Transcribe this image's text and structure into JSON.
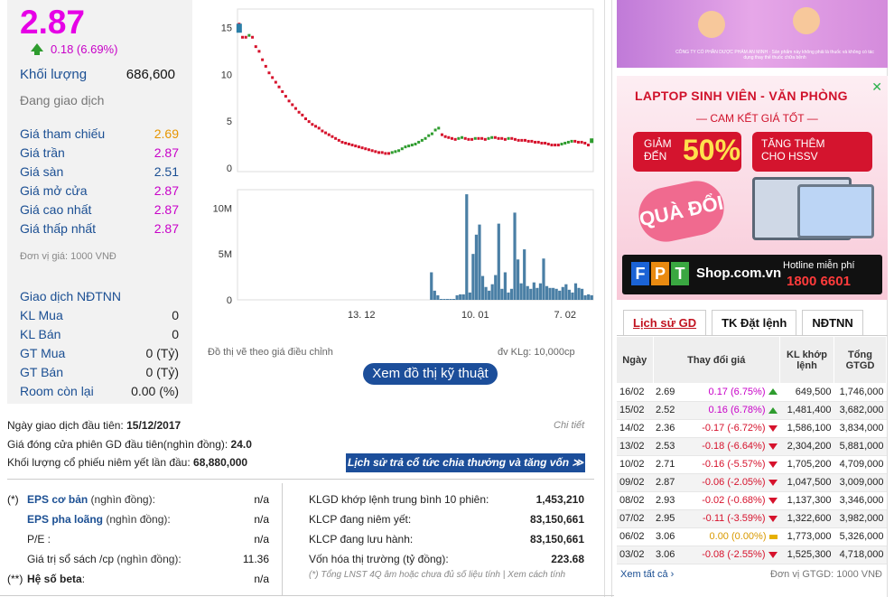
{
  "price": {
    "current": "2.87",
    "change": "0.18 (6.69%)",
    "volume_label": "Khối lượng",
    "volume_value": "686,600",
    "status": "Đang giao dịch"
  },
  "ref_prices": [
    {
      "label": "Giá tham chiếu",
      "value": "2.69",
      "color": "#e69500"
    },
    {
      "label": "Giá trần",
      "value": "2.87",
      "color": "#c800c8"
    },
    {
      "label": "Giá sàn",
      "value": "2.51",
      "color": "#1b4f93"
    },
    {
      "label": "Giá mở cửa",
      "value": "2.87",
      "color": "#c800c8"
    },
    {
      "label": "Giá cao nhất",
      "value": "2.87",
      "color": "#c800c8"
    },
    {
      "label": "Giá thấp nhất",
      "value": "2.87",
      "color": "#c800c8"
    }
  ],
  "unit_note": "Đơn vị giá: 1000 VNĐ",
  "foreign": {
    "title": "Giao dịch NĐTNN",
    "rows": [
      {
        "label": "KL Mua",
        "value": "0"
      },
      {
        "label": "KL Bán",
        "value": "0"
      },
      {
        "label": "GT Mua",
        "value": "0 (Tỷ)"
      },
      {
        "label": "GT Bán",
        "value": "0 (Tỷ)"
      },
      {
        "label": "Room còn lại",
        "value": "0.00 (%)"
      }
    ]
  },
  "chart_data": [
    {
      "type": "line",
      "series": [],
      "y_ticks": [
        "15",
        "10",
        "5",
        "0"
      ],
      "ylim": [
        0,
        16
      ],
      "x": [
        0,
        1,
        2,
        3,
        4,
        5,
        6,
        7,
        8,
        9,
        10,
        11,
        12,
        13,
        14,
        15,
        16,
        17,
        18,
        19,
        20,
        21,
        22,
        23,
        24,
        25,
        26,
        27,
        28,
        29,
        30,
        31,
        32,
        33,
        34,
        35,
        36,
        37,
        38,
        39,
        40,
        41,
        42,
        43,
        44,
        45,
        46,
        47,
        48,
        49,
        50,
        51,
        52,
        53,
        54,
        55,
        56,
        57,
        58,
        59,
        60,
        61,
        62,
        63,
        64,
        65,
        66,
        67,
        68,
        69,
        70,
        71,
        72,
        73,
        74,
        75,
        76,
        77,
        78,
        79,
        80,
        81,
        82,
        83,
        84,
        85,
        86,
        87,
        88,
        89,
        90,
        91,
        92,
        93,
        94,
        95,
        96,
        97,
        98,
        99,
        100,
        101,
        102,
        103,
        104,
        105,
        106
      ],
      "values": [
        15.4,
        14.0,
        14.0,
        14.2,
        14.0,
        13.0,
        12.5,
        11.6,
        10.9,
        10.2,
        9.7,
        9.2,
        8.7,
        8.2,
        7.7,
        7.2,
        6.8,
        6.4,
        6.0,
        5.7,
        5.3,
        5.0,
        4.7,
        4.5,
        4.3,
        4.0,
        3.8,
        3.6,
        3.4,
        3.2,
        3.0,
        2.8,
        2.7,
        2.6,
        2.5,
        2.4,
        2.3,
        2.2,
        2.1,
        2.0,
        1.9,
        1.8,
        1.7,
        1.7,
        1.6,
        1.6,
        1.7,
        1.8,
        1.9,
        2.1,
        2.3,
        2.4,
        2.5,
        2.6,
        2.8,
        3.0,
        3.2,
        3.5,
        3.7,
        4.1,
        4.3,
        3.6,
        3.4,
        3.3,
        3.2,
        3.1,
        3.2,
        3.3,
        3.2,
        3.1,
        3.1,
        3.2,
        3.2,
        3.2,
        3.1,
        3.2,
        3.3,
        3.3,
        3.2,
        3.2,
        3.1,
        3.2,
        3.2,
        3.1,
        3.0,
        3.0,
        3.0,
        2.9,
        2.9,
        2.8,
        2.8,
        2.7,
        2.7,
        2.6,
        2.5,
        2.5,
        2.5,
        2.6,
        2.7,
        2.8,
        2.9,
        2.9,
        2.8,
        2.8,
        2.7,
        2.5,
        2.87
      ]
    },
    {
      "type": "bar",
      "y_ticks": [
        "10M",
        "5M",
        "0"
      ],
      "ylim": [
        0,
        12
      ],
      "x_ticks": [
        "13. 12",
        "10. 01",
        "7. 02"
      ],
      "values": [
        0,
        0,
        0,
        0,
        0,
        0,
        0,
        0,
        0,
        0,
        0,
        0,
        0,
        0,
        0,
        0,
        0,
        0,
        0,
        0,
        0,
        0,
        0,
        0,
        0,
        0,
        0,
        0,
        0,
        0,
        0,
        0,
        0,
        0,
        0,
        0,
        0,
        0,
        0,
        0,
        0,
        0,
        0,
        0,
        0,
        0,
        0,
        0,
        0,
        0,
        0,
        0,
        0,
        0,
        0,
        0,
        0,
        0,
        0,
        0,
        3.0,
        1.0,
        0.5,
        0.1,
        0.1,
        0.1,
        0.1,
        0.1,
        0.5,
        0.6,
        0.6,
        11.5,
        0.8,
        5.0,
        7.1,
        8.2,
        2.6,
        1.4,
        1.0,
        1.7,
        2.7,
        8.3,
        1.2,
        3.0,
        0.8,
        1.2,
        9.5,
        4.4,
        1.8,
        5.5,
        1.5,
        1.2,
        1.9,
        1.3,
        1.8,
        4.5,
        1.5,
        1.3,
        1.3,
        1.2,
        1.0,
        1.4,
        1.7,
        1.1,
        0.8,
        1.8,
        1.3,
        1.2,
        0.5,
        0.6,
        0.5
      ]
    }
  ],
  "chart_note": "Đồ thị vẽ theo giá điều chỉnh",
  "chart_unit": "đv KLg: 10,000cp",
  "tech_button": "Xem đồ thị kỹ thuật",
  "first_day": {
    "label": "Ngày giao dịch đầu tiên:",
    "value": "15/12/2017"
  },
  "detail_link": "Chi tiết",
  "first_close": {
    "label": "Giá đóng cửa phiên GD đầu tiên(nghìn đồng):",
    "value": "24.0"
  },
  "listed_vol": {
    "label": "Khối lượng cổ phiếu niêm yết lần đầu:",
    "value": "68,880,000"
  },
  "dividend_button": "Lịch sử trả cổ tức chia thưởng và tăng vốn ≫",
  "eps_rows": [
    {
      "mark": "(*)",
      "name": "EPS cơ bản",
      "sub": " (nghìn đồng):",
      "value": "n/a"
    },
    {
      "mark": "",
      "name": "EPS pha loãng",
      "sub": " (nghìn đồng):",
      "value": "n/a"
    },
    {
      "mark": "",
      "name": "P/E",
      "sub": " :",
      "value": "n/a"
    },
    {
      "mark": "",
      "name": "Giá trị sổ sách /cp",
      "sub": " (nghìn đồng):",
      "value": "11.36"
    },
    {
      "mark": "(**)",
      "name": "Hệ số beta",
      "sub": ":",
      "value": "n/a"
    }
  ],
  "klgd_rows": [
    {
      "label": "KLGD khớp lệnh trung bình 10 phiên:",
      "value": "1,453,210"
    },
    {
      "label": "KLCP đang niêm yết:",
      "value": "83,150,661"
    },
    {
      "label": "KLCP đang lưu hành:",
      "value": "83,150,661"
    },
    {
      "label": "Vốn hóa thị trường",
      "sub": " (tỷ đồng):",
      "value": "223.68"
    }
  ],
  "foot_note": "(*) Tổng LNST 4Q âm hoặc chưa đủ số liệu tính | Xem cách tính",
  "ad1_text": "CÔNG TY CỔ PHẦN DƯỢC PHẨM AN MINH · Sản phẩm này không phải là thuốc và không có tác dụng thay thế thuốc chữa bệnh",
  "ad2": {
    "title": "LAPTOP SINH VIÊN - VĂN PHÒNG",
    "sub": "— CAM KẾT GIÁ TỐT —",
    "box1_a": "GIẢM",
    "box1_b": "ĐẾN",
    "box1_big": "50%",
    "box2_a": "TĂNG THÊM",
    "box2_b": "CHO HSSV",
    "upgrade": "QUÀ ĐỔI",
    "shop": "Shop.com.vn",
    "hotline": "Hotline miễn phí",
    "hotline_num": "1800 6601"
  },
  "tabs": [
    "Lịch sử GD",
    "TK Đặt lệnh",
    "NĐTNN"
  ],
  "history_headers": [
    "Ngày",
    "Thay đổi giá",
    "KL khớp lệnh",
    "Tổng GTGD"
  ],
  "history": [
    {
      "date": "16/02",
      "price": "2.69",
      "change": "0.17 (6.75%)",
      "dir": "up",
      "vol": "649,500",
      "val": "1,746,000"
    },
    {
      "date": "15/02",
      "price": "2.52",
      "change": "0.16 (6.78%)",
      "dir": "up",
      "vol": "1,481,400",
      "val": "3,682,000"
    },
    {
      "date": "14/02",
      "price": "2.36",
      "change": "-0.17 (-6.72%)",
      "dir": "down",
      "vol": "1,586,100",
      "val": "3,834,000"
    },
    {
      "date": "13/02",
      "price": "2.53",
      "change": "-0.18 (-6.64%)",
      "dir": "down",
      "vol": "2,304,200",
      "val": "5,881,000"
    },
    {
      "date": "10/02",
      "price": "2.71",
      "change": "-0.16 (-5.57%)",
      "dir": "down",
      "vol": "1,705,200",
      "val": "4,709,000"
    },
    {
      "date": "09/02",
      "price": "2.87",
      "change": "-0.06 (-2.05%)",
      "dir": "down",
      "vol": "1,047,500",
      "val": "3,009,000"
    },
    {
      "date": "08/02",
      "price": "2.93",
      "change": "-0.02 (-0.68%)",
      "dir": "down",
      "vol": "1,137,300",
      "val": "3,346,000"
    },
    {
      "date": "07/02",
      "price": "2.95",
      "change": "-0.11 (-3.59%)",
      "dir": "down",
      "vol": "1,322,600",
      "val": "3,982,000"
    },
    {
      "date": "06/02",
      "price": "3.06",
      "change": "0.00 (0.00%)",
      "dir": "flat",
      "vol": "1,773,000",
      "val": "5,326,000"
    },
    {
      "date": "03/02",
      "price": "3.06",
      "change": "-0.08 (-2.55%)",
      "dir": "down",
      "vol": "1,525,300",
      "val": "4,718,000"
    }
  ],
  "see_all": "Xem tất cả ›",
  "gtgd_unit": "Đơn vị GTGD: 1000 VNĐ"
}
